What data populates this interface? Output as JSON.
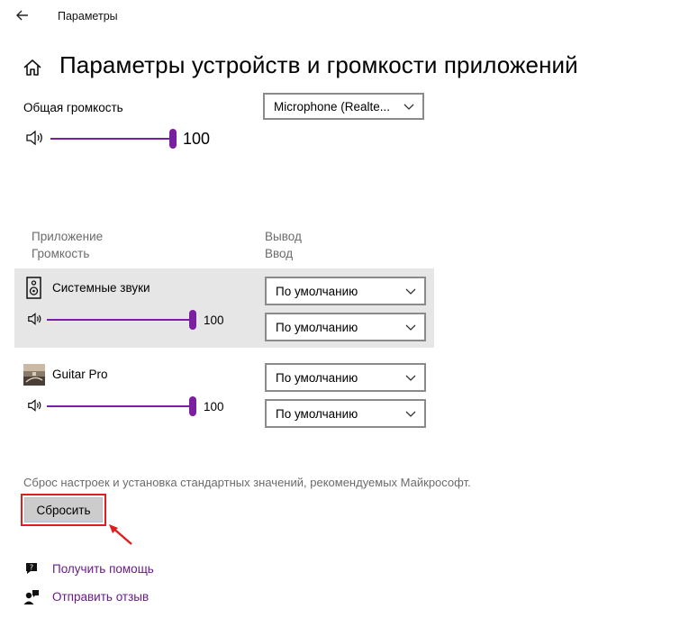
{
  "window": {
    "title": "Параметры"
  },
  "page": {
    "title": "Параметры устройств и громкости приложений"
  },
  "master": {
    "label": "Общая громкость",
    "volume": "100",
    "volume_fraction": 1.0,
    "input_device": "Microphone (Realte..."
  },
  "table": {
    "header_app": "Приложение",
    "header_volume": "Громкость",
    "header_output": "Вывод",
    "header_input": "Ввод"
  },
  "apps": [
    {
      "name": "Системные звуки",
      "volume": "100",
      "volume_fraction": 1.0,
      "output": "По умолчанию",
      "input": "По умолчанию"
    },
    {
      "name": "Guitar Pro",
      "volume": "100",
      "volume_fraction": 1.0,
      "output": "По умолчанию",
      "input": "По умолчанию"
    }
  ],
  "reset": {
    "description": "Сброс настроек и установка стандартных значений, рекомендуемых Майкрософт.",
    "button_label": "Сбросить"
  },
  "links": {
    "help": "Получить помощь",
    "feedback": "Отправить отзыв"
  },
  "colors": {
    "accent": "#7a1fa2",
    "link": "#6a1b8a",
    "highlight_row": "#e6e6e6",
    "annotation_red": "#e01e1e"
  },
  "icons": {
    "back": "back-arrow-icon",
    "home": "home-icon",
    "speaker": "speaker-volume-icon",
    "system_sounds": "speaker-box-icon",
    "guitar_pro": "guitar-pro-app-icon",
    "chevron": "chevron-down-icon",
    "help": "help-chat-icon",
    "feedback": "feedback-person-icon",
    "annotation": "red-arrow-annotation"
  }
}
